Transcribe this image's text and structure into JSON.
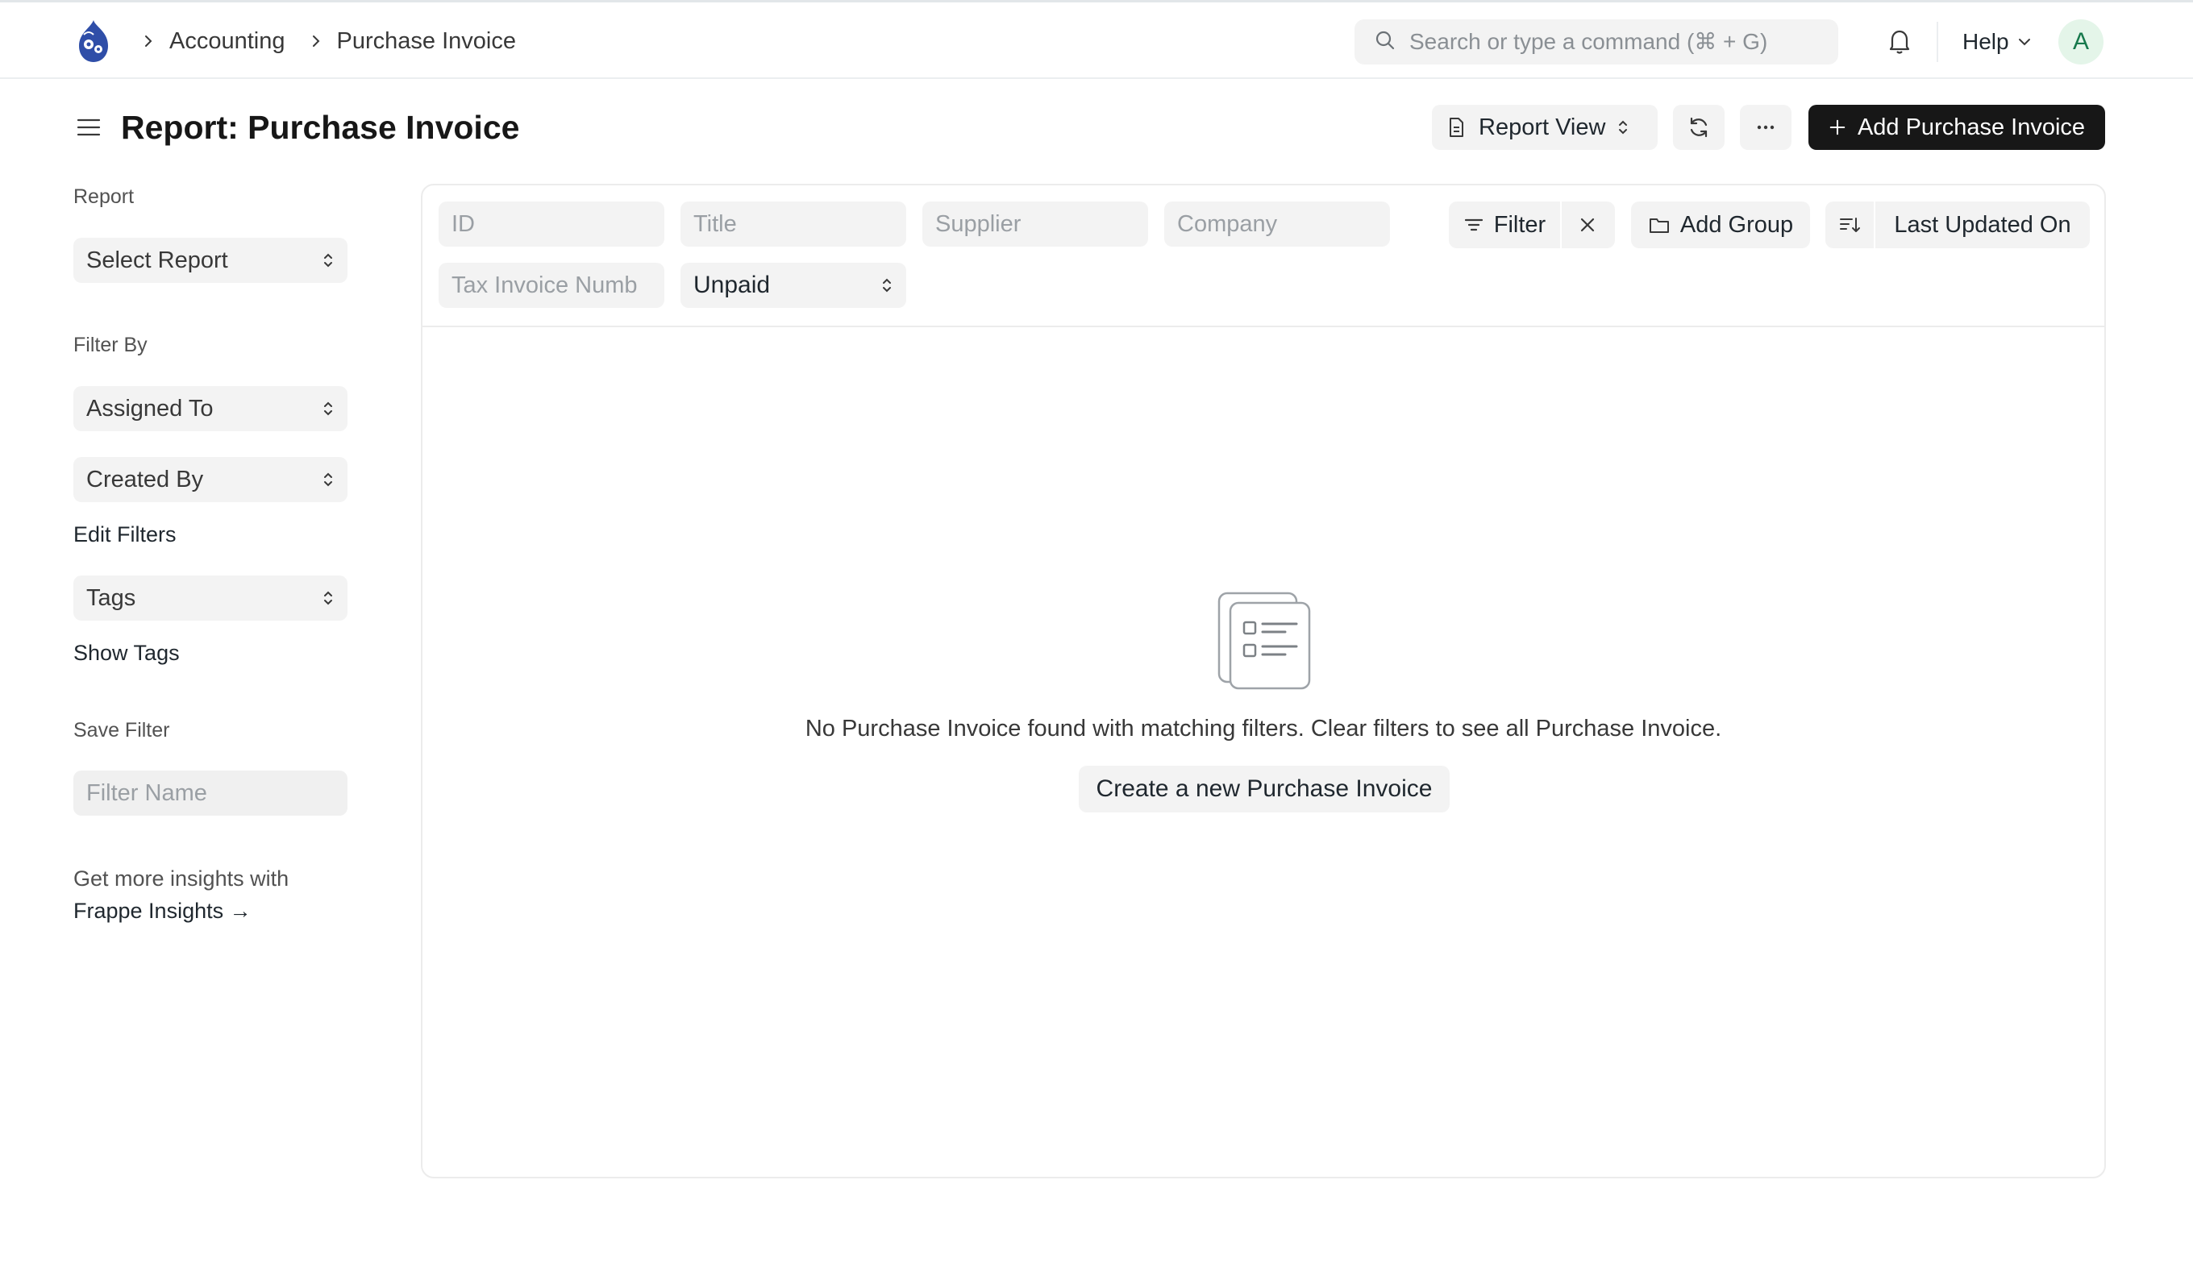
{
  "navbar": {
    "breadcrumbs": [
      "Accounting",
      "Purchase Invoice"
    ],
    "search_placeholder": "Search or type a command (⌘ + G)",
    "help_label": "Help",
    "avatar_initial": "A"
  },
  "page": {
    "title": "Report: Purchase Invoice",
    "view_label": "Report View",
    "primary_action": "Add Purchase Invoice"
  },
  "sidebar": {
    "report_label": "Report",
    "select_report": "Select Report",
    "filter_by_label": "Filter By",
    "assigned_to": "Assigned To",
    "created_by": "Created By",
    "edit_filters": "Edit Filters",
    "tags": "Tags",
    "show_tags": "Show Tags",
    "save_filter_label": "Save Filter",
    "filter_name_placeholder": "Filter Name",
    "insights_text": "Get more insights with",
    "insights_link": "Frappe Insights →"
  },
  "filters": {
    "id_placeholder": "ID",
    "title_placeholder": "Title",
    "supplier_placeholder": "Supplier",
    "company_placeholder": "Company",
    "tax_invoice_placeholder": "Tax Invoice Numb",
    "status_value": "Unpaid",
    "filter_label": "Filter",
    "add_group_label": "Add Group",
    "sort_label": "Last Updated On"
  },
  "empty_state": {
    "message": "No Purchase Invoice found with matching filters. Clear filters to see all Purchase Invoice.",
    "create_label": "Create a new Purchase Invoice"
  },
  "colors": {
    "primary_button": "#171717",
    "avatar_bg": "#e4f5e9",
    "avatar_fg": "#16794c",
    "logo": "#2f4ea8"
  }
}
